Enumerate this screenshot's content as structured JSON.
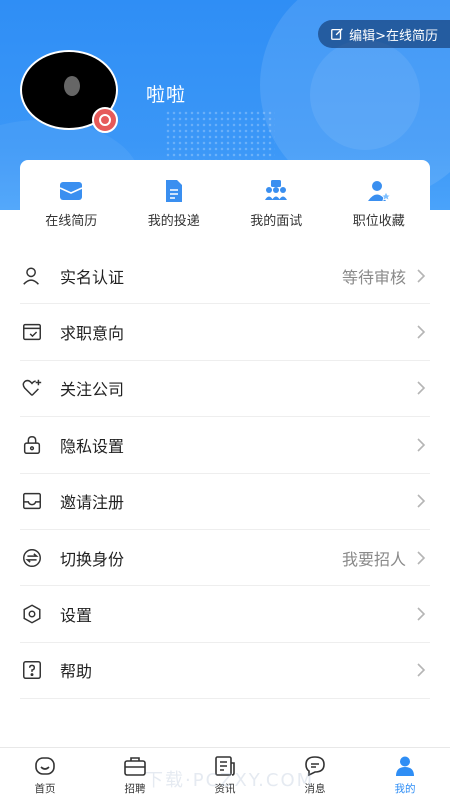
{
  "header": {
    "edit_label": "编辑>在线简历",
    "username": "啦啦"
  },
  "quick_actions": [
    {
      "label": "在线简历",
      "icon": "mail-tray-icon"
    },
    {
      "label": "我的投递",
      "icon": "document-icon"
    },
    {
      "label": "我的面试",
      "icon": "interview-icon"
    },
    {
      "label": "职位收藏",
      "icon": "user-star-icon"
    }
  ],
  "menu": [
    {
      "label": "实名认证",
      "value": "等待审核",
      "icon": "user-outline-icon"
    },
    {
      "label": "求职意向",
      "value": "",
      "icon": "intention-icon"
    },
    {
      "label": "关注公司",
      "value": "",
      "icon": "heart-plus-icon"
    },
    {
      "label": "隐私设置",
      "value": "",
      "icon": "lock-icon"
    },
    {
      "label": "邀请注册",
      "value": "",
      "icon": "inbox-icon"
    },
    {
      "label": "切换身份",
      "value": "我要招人",
      "icon": "switch-icon"
    },
    {
      "label": "设置",
      "value": "",
      "icon": "settings-hex-icon"
    },
    {
      "label": "帮助",
      "value": "",
      "icon": "help-icon"
    }
  ],
  "tabs": [
    {
      "label": "首页",
      "icon": "home-icon",
      "active": false
    },
    {
      "label": "招聘",
      "icon": "briefcase-icon",
      "active": false
    },
    {
      "label": "资讯",
      "icon": "news-icon",
      "active": false
    },
    {
      "label": "消息",
      "icon": "message-icon",
      "active": false
    },
    {
      "label": "我的",
      "icon": "profile-icon",
      "active": true
    }
  ],
  "watermark": "下载·PCZXY.COM",
  "colors": {
    "primary": "#2f8ef5",
    "text": "#222222",
    "muted": "#8a8a8a",
    "badge": "#e65a5a"
  }
}
